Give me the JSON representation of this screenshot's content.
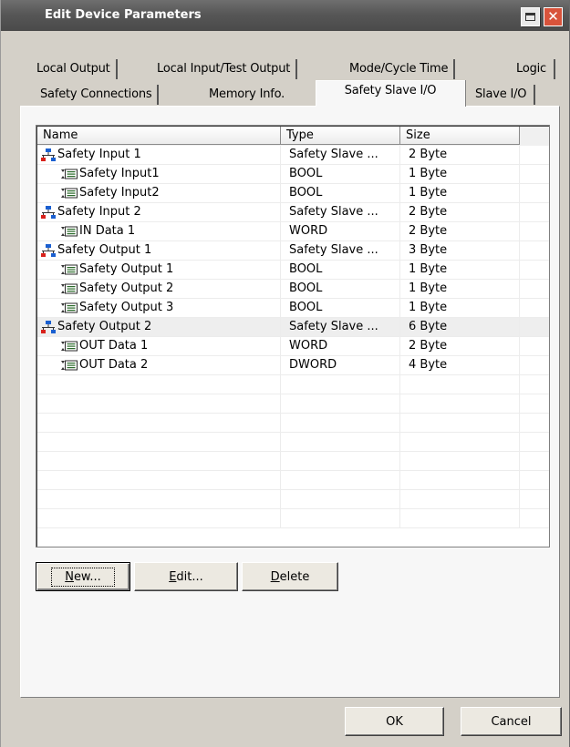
{
  "window": {
    "title": "Edit Device Parameters"
  },
  "tabs_row1": [
    {
      "label": "Local Output"
    },
    {
      "label": "Local Input/Test Output"
    },
    {
      "label": "Mode/Cycle Time"
    },
    {
      "label": "Logic"
    }
  ],
  "tabs_row2": [
    {
      "label": "Safety Connections"
    },
    {
      "label": "Memory Info."
    },
    {
      "label": "Safety Slave I/O",
      "active": true
    },
    {
      "label": "Slave I/O"
    }
  ],
  "list": {
    "columns": [
      "Name",
      "Type",
      "Size"
    ],
    "rows": [
      {
        "name": "Safety Input 1",
        "type": "Safety Slave ...",
        "size": "2 Byte",
        "level": 0,
        "icon": "network-node-icon"
      },
      {
        "name": "Safety Input1",
        "type": "BOOL",
        "size": "1 Byte",
        "level": 1,
        "icon": "io-tag-icon"
      },
      {
        "name": "Safety Input2",
        "type": "BOOL",
        "size": "1 Byte",
        "level": 1,
        "icon": "io-tag-icon"
      },
      {
        "name": "Safety Input 2",
        "type": "Safety Slave ...",
        "size": "2 Byte",
        "level": 0,
        "icon": "network-node-icon"
      },
      {
        "name": "IN Data 1",
        "type": "WORD",
        "size": "2 Byte",
        "level": 1,
        "icon": "io-tag-icon"
      },
      {
        "name": "Safety Output 1",
        "type": "Safety Slave ...",
        "size": "3 Byte",
        "level": 0,
        "icon": "network-node-icon"
      },
      {
        "name": "Safety Output 1",
        "type": "BOOL",
        "size": "1 Byte",
        "level": 1,
        "icon": "io-tag-icon"
      },
      {
        "name": "Safety Output 2",
        "type": "BOOL",
        "size": "1 Byte",
        "level": 1,
        "icon": "io-tag-icon"
      },
      {
        "name": "Safety Output 3",
        "type": "BOOL",
        "size": "1 Byte",
        "level": 1,
        "icon": "io-tag-icon"
      },
      {
        "name": "Safety Output 2",
        "type": "Safety Slave ...",
        "size": "6 Byte",
        "level": 0,
        "icon": "network-node-icon",
        "selected": true
      },
      {
        "name": "OUT Data 1",
        "type": "WORD",
        "size": "2 Byte",
        "level": 1,
        "icon": "io-tag-icon"
      },
      {
        "name": "OUT Data 2",
        "type": "DWORD",
        "size": "4 Byte",
        "level": 1,
        "icon": "io-tag-icon"
      }
    ]
  },
  "buttons": {
    "new": {
      "mnemonic": "N",
      "rest": "ew..."
    },
    "edit": {
      "mnemonic": "E",
      "rest": "dit..."
    },
    "delete": {
      "mnemonic": "D",
      "rest": "elete"
    },
    "ok": "OK",
    "cancel": "Cancel"
  },
  "colors": {
    "node_icon_blue": "#1a5fd0",
    "node_icon_red": "#d8211b",
    "close_red": "#d8533b"
  }
}
